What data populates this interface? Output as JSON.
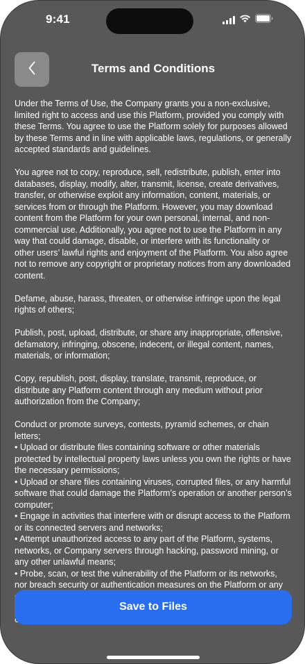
{
  "status_bar": {
    "time": "9:41"
  },
  "header": {
    "title": "Terms and Conditions"
  },
  "terms": {
    "paragraphs": [
      "Under the Terms of Use, the Company grants you a non-exclusive, limited right to access and use this Platform, provided you comply with these Terms. You agree to use the Platform solely for purposes allowed by these Terms and in line with applicable laws, regulations, or generally accepted standards and guidelines.",
      "You agree not to copy, reproduce, sell, redistribute, publish, enter into databases, display, modify, alter, transmit, license, create derivatives, transfer, or otherwise exploit any information, content, materials, or services from or through the Platform. However, you may download content from the Platform for your own personal, internal, and non-commercial use. Additionally, you agree not to use the Platform in any way that could damage, disable, or interfere with its functionality or other users’ lawful rights and enjoyment of the Platform. You also agree not to remove any copyright or proprietary notices from any downloaded content.",
      "Defame, abuse, harass, threaten, or otherwise infringe upon the legal rights of others;",
      "Publish, post, upload, distribute, or share any inappropriate, offensive, defamatory, infringing, obscene, indecent, or illegal content, names, materials, or information;",
      "Copy, republish, post, display, translate, transmit, reproduce, or distribute any Platform content through any medium without prior authorization from the Company;",
      "Conduct or promote surveys, contests, pyramid schemes, or chain letters;"
    ],
    "bullets": [
      "• Upload or distribute files containing software or other materials protected by intellectual property laws unless you own the rights or have the necessary permissions;",
      "• Upload or share files containing viruses, corrupted files, or any harmful software that could damage the Platform’s operation or another person’s computer;",
      "• Engage in activities that interfere with or disrupt access to the Platform or its connected servers and networks;",
      "• Attempt unauthorized access to any part of the Platform, systems, networks, or Company servers through hacking, password mining, or any other unlawful means;",
      "• Probe, scan, or test the vulnerability of the Platform or its networks, nor breach security or authentication measures on the Platform or any connected network. You may not try to reverse look-up, trace, or uncover any information about other users or visitors to the Platform, except for your own information as provided on the Platform;"
    ]
  },
  "footer": {
    "save_label": "Save to Files"
  },
  "colors": {
    "background": "#585858",
    "accent": "#2a6ef0",
    "back_button": "#8a8a8a"
  },
  "icons": {
    "back": "chevron-left-icon",
    "signal": "cellular-signal-icon",
    "wifi": "wifi-icon",
    "battery": "battery-icon"
  }
}
